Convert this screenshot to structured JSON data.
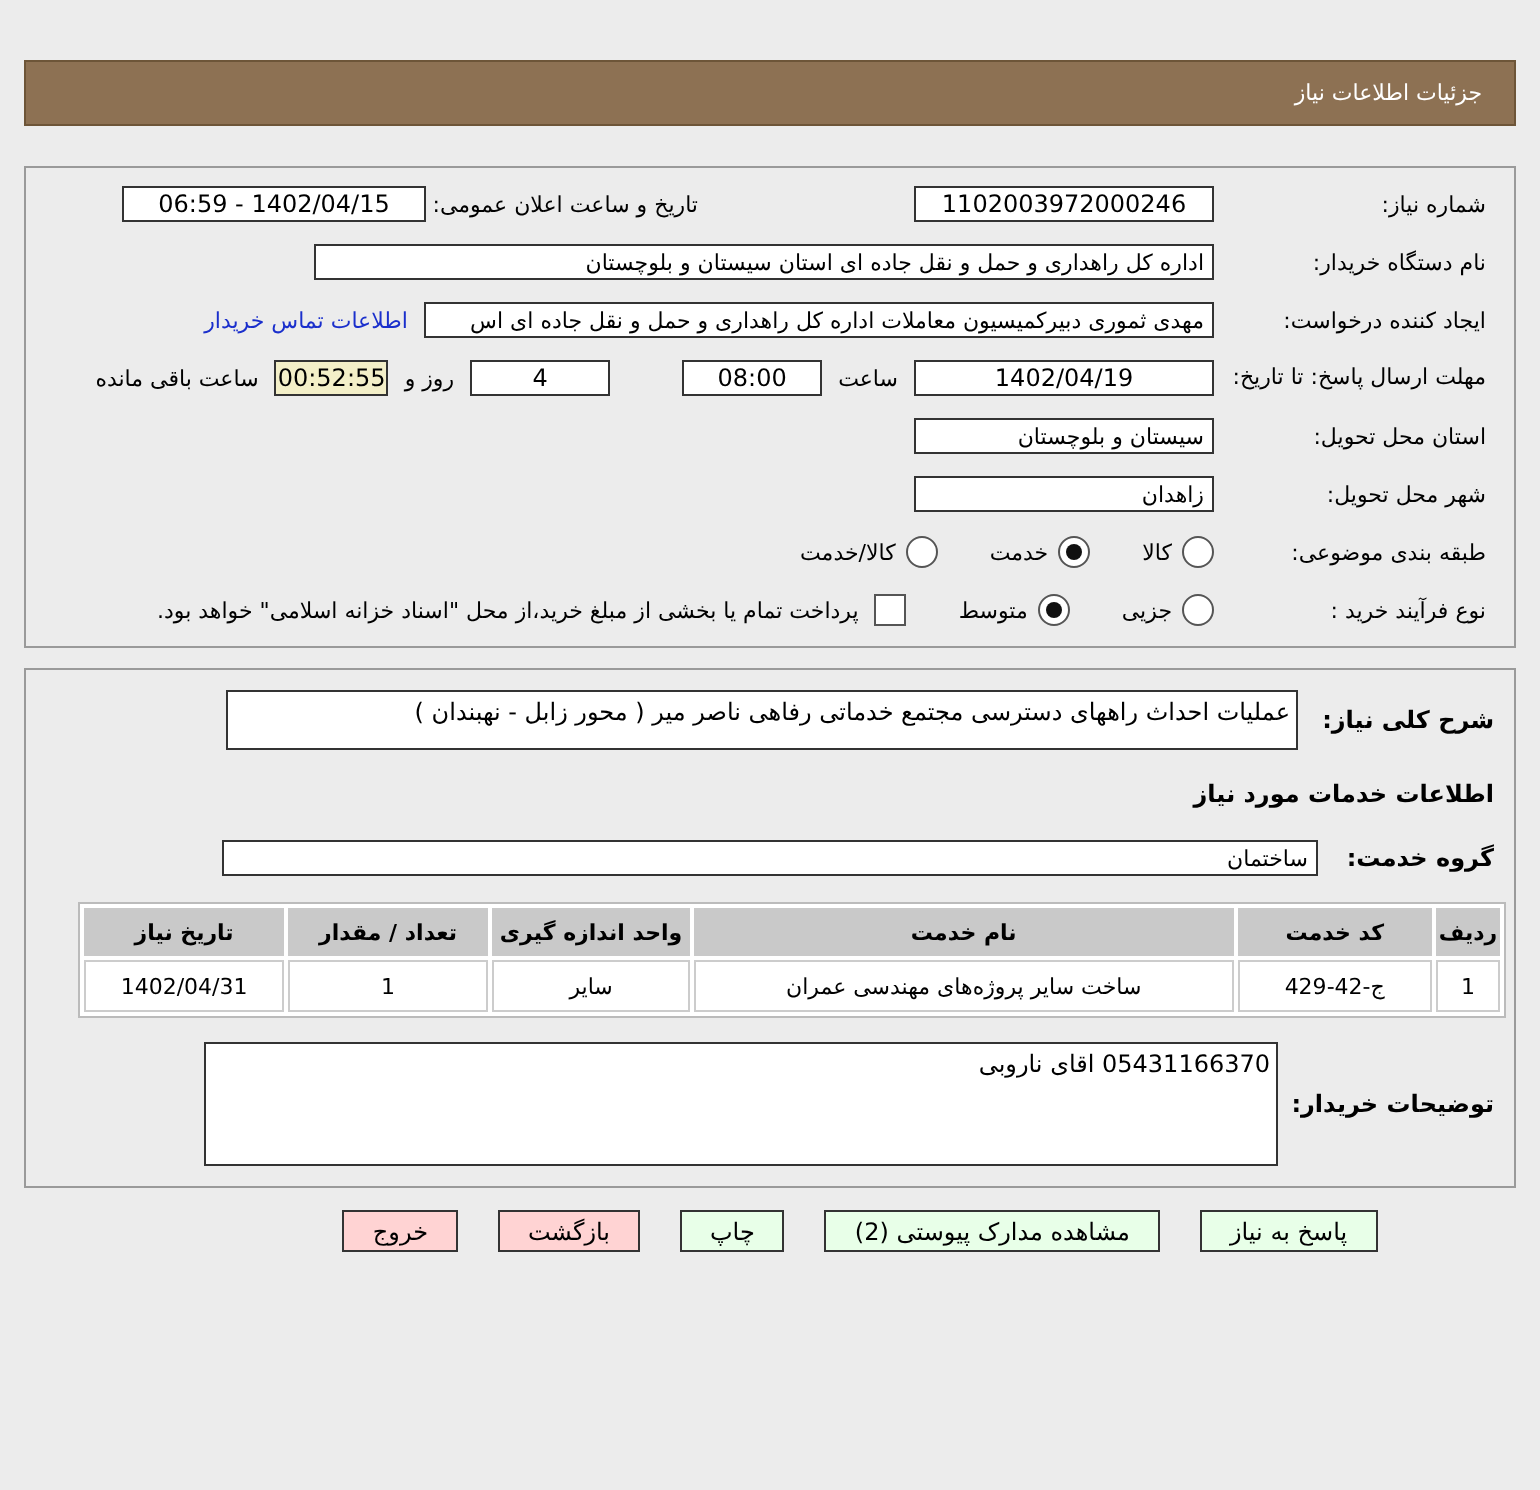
{
  "header": {
    "title": "جزئیات اطلاعات نیاز"
  },
  "need_number": {
    "label": "شماره نیاز:",
    "value": "1102003972000246"
  },
  "announce": {
    "label": "تاریخ و ساعت اعلان عمومی:",
    "value": "1402/04/15 - 06:59"
  },
  "buyer_org": {
    "label": "نام دستگاه خریدار:",
    "value": "اداره کل راهداری و حمل و نقل جاده ای استان سیستان و بلوچستان"
  },
  "requester": {
    "label": "ایجاد کننده درخواست:",
    "value": "مهدی ثموری دبیرکمیسیون معاملات اداره کل راهداری و حمل و نقل جاده ای اس",
    "link": "اطلاعات تماس خریدار"
  },
  "deadline": {
    "label": "مهلت ارسال پاسخ: تا تاریخ:",
    "date": "1402/04/19",
    "time_label": "ساعت",
    "time": "08:00",
    "days": "4",
    "days_label": "روز و",
    "remaining": "00:52:55",
    "remaining_label": "ساعت باقی مانده"
  },
  "province": {
    "label": "استان محل تحویل:",
    "value": "سیستان و بلوچستان"
  },
  "city": {
    "label": "شهر محل تحویل:",
    "value": "زاهدان"
  },
  "category": {
    "label": "طبقه بندی موضوعی:",
    "options": [
      {
        "label": "کالا",
        "selected": false
      },
      {
        "label": "خدمت",
        "selected": true
      },
      {
        "label": "کالا/خدمت",
        "selected": false
      }
    ]
  },
  "process": {
    "label": "نوع فرآیند خرید :",
    "options": [
      {
        "label": "جزیی",
        "selected": false
      },
      {
        "label": "متوسط",
        "selected": true
      }
    ],
    "payment": {
      "checked": false,
      "label": "پرداخت تمام یا بخشی از مبلغ خرید،از محل \"اسناد خزانه اسلامی\" خواهد بود."
    }
  },
  "description": {
    "label": "شرح کلی نیاز:",
    "value": "عملیات احداث راههای دسترسی مجتمع خدماتی رفاهی ناصر میر ( محور زابل - نهبندان )"
  },
  "services_title": "اطلاعات خدمات مورد نیاز",
  "service_group": {
    "label": "گروه خدمت:",
    "value": "ساختمان"
  },
  "table": {
    "columns": [
      "ردیف",
      "کد خدمت",
      "نام خدمت",
      "واحد اندازه گیری",
      "تعداد / مقدار",
      "تاریخ نیاز"
    ],
    "rows": [
      [
        "1",
        "ج-42-429",
        "ساخت سایر پروژه‌های مهندسی عمران",
        "سایر",
        "1",
        "1402/04/31"
      ]
    ]
  },
  "buyer_notes": {
    "label": "توضیحات خریدار:",
    "value": "05431166370 اقای ناروبی"
  },
  "buttons": [
    {
      "label": "پاسخ به نیاز",
      "kind": "normal"
    },
    {
      "label": "مشاهده مدارک پیوستی (2)",
      "kind": "normal"
    },
    {
      "label": "چاپ",
      "kind": "normal"
    },
    {
      "label": "بازگشت",
      "kind": "exit"
    },
    {
      "label": "خروج",
      "kind": "exit"
    }
  ]
}
